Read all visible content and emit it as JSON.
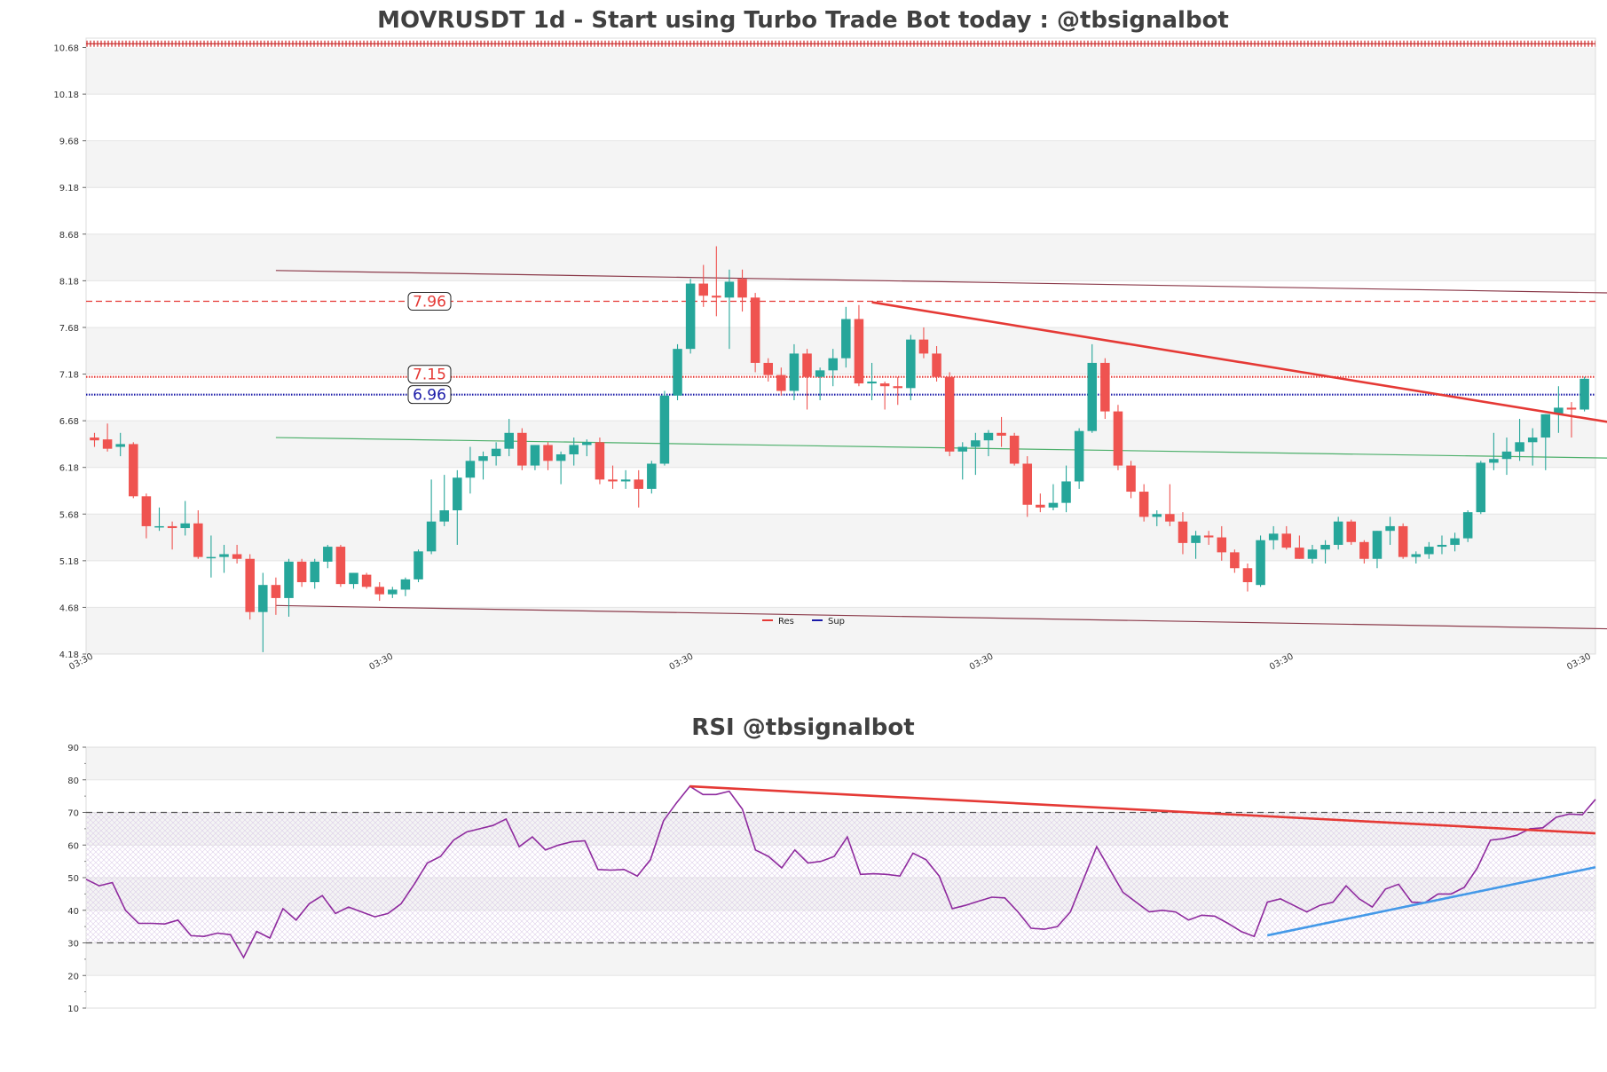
{
  "chart_data": [
    {
      "type": "candlestick",
      "title": "MOVRUSDT 1d - Start using Turbo Trade Bot today : @tbsignalbot",
      "ylim": [
        4.18,
        10.78
      ],
      "y_ticks": [
        "4.18",
        "4.68",
        "5.18",
        "5.68",
        "6.18",
        "6.68",
        "7.18",
        "7.68",
        "8.18",
        "8.68",
        "9.18",
        "9.68",
        "10.18",
        "10.68"
      ],
      "x_tick_labels": [
        "03:30",
        "03:30",
        "03:30",
        "03:30",
        "03:30",
        "03:30"
      ],
      "colors": {
        "up": "#26a69a",
        "down": "#ef5350",
        "resistance": "#e53935",
        "support": "#1a1aa8",
        "channel": "#8b3a4a",
        "mid_channel": "#4caf6a"
      },
      "levels": [
        {
          "label": "7.96",
          "value": 7.96,
          "kind": "resistance",
          "style": "dashed"
        },
        {
          "label": "7.15",
          "value": 7.15,
          "kind": "resistance",
          "style": "dotted"
        },
        {
          "label": "6.96",
          "value": 6.96,
          "kind": "support",
          "style": "dotted"
        }
      ],
      "top_marker_level": 10.72,
      "legend": [
        {
          "name": "Res",
          "color": "#e53935"
        },
        {
          "name": "Sup",
          "color": "#1a1aa8"
        }
      ],
      "channel_lines": [
        {
          "start_index": 14,
          "start": 8.29,
          "end_index": 117,
          "end": 8.05,
          "color": "#8b3a4a"
        },
        {
          "start_index": 14,
          "start": 6.5,
          "end_index": 117,
          "end": 6.28,
          "color": "#4caf6a"
        },
        {
          "start_index": 14,
          "start": 4.7,
          "end_index": 117,
          "end": 4.45,
          "color": "#8b3a4a"
        }
      ],
      "trendline": {
        "start_index": 60,
        "start": 7.95,
        "end_index": 118,
        "end": 6.64,
        "color": "#e53935"
      },
      "candles": [
        [
          6.5,
          6.55,
          6.4,
          6.47
        ],
        [
          6.48,
          6.65,
          6.35,
          6.38
        ],
        [
          6.4,
          6.55,
          6.3,
          6.43
        ],
        [
          6.43,
          6.45,
          5.85,
          5.87
        ],
        [
          5.87,
          5.9,
          5.42,
          5.55
        ],
        [
          5.55,
          5.75,
          5.5,
          5.55
        ],
        [
          5.55,
          5.6,
          5.3,
          5.53
        ],
        [
          5.53,
          5.82,
          5.45,
          5.58
        ],
        [
          5.58,
          5.72,
          5.2,
          5.22
        ],
        [
          5.22,
          5.45,
          5.0,
          5.22
        ],
        [
          5.22,
          5.35,
          5.05,
          5.25
        ],
        [
          5.25,
          5.35,
          5.15,
          5.2
        ],
        [
          5.2,
          5.25,
          4.55,
          4.63
        ],
        [
          4.63,
          5.05,
          4.2,
          4.92
        ],
        [
          4.92,
          5.0,
          4.6,
          4.78
        ],
        [
          4.78,
          5.2,
          4.58,
          5.17
        ],
        [
          5.17,
          5.2,
          4.9,
          4.95
        ],
        [
          4.95,
          5.2,
          4.88,
          5.17
        ],
        [
          5.17,
          5.35,
          5.1,
          5.33
        ],
        [
          5.33,
          5.35,
          4.9,
          4.93
        ],
        [
          4.93,
          5.05,
          4.88,
          5.05
        ],
        [
          5.03,
          5.05,
          4.88,
          4.9
        ],
        [
          4.9,
          4.95,
          4.75,
          4.82
        ],
        [
          4.82,
          4.9,
          4.78,
          4.87
        ],
        [
          4.87,
          5.0,
          4.8,
          4.98
        ],
        [
          4.98,
          5.3,
          4.95,
          5.28
        ],
        [
          5.28,
          6.05,
          5.25,
          5.6
        ],
        [
          5.6,
          6.1,
          5.55,
          5.72
        ],
        [
          5.72,
          6.15,
          5.35,
          6.07
        ],
        [
          6.07,
          6.4,
          5.9,
          6.25
        ],
        [
          6.25,
          6.35,
          6.05,
          6.3
        ],
        [
          6.3,
          6.45,
          6.2,
          6.38
        ],
        [
          6.38,
          6.7,
          6.3,
          6.55
        ],
        [
          6.55,
          6.6,
          6.15,
          6.2
        ],
        [
          6.2,
          6.42,
          6.15,
          6.42
        ],
        [
          6.42,
          6.45,
          6.15,
          6.25
        ],
        [
          6.25,
          6.35,
          6.0,
          6.32
        ],
        [
          6.32,
          6.5,
          6.2,
          6.42
        ],
        [
          6.42,
          6.48,
          6.3,
          6.45
        ],
        [
          6.45,
          6.5,
          6.0,
          6.05
        ],
        [
          6.05,
          6.2,
          5.95,
          6.03
        ],
        [
          6.03,
          6.15,
          5.95,
          6.05
        ],
        [
          6.05,
          6.15,
          5.75,
          5.95
        ],
        [
          5.95,
          6.25,
          5.9,
          6.22
        ],
        [
          6.22,
          7.0,
          6.2,
          6.95
        ],
        [
          6.95,
          7.5,
          6.9,
          7.45
        ],
        [
          7.45,
          8.2,
          7.4,
          8.15
        ],
        [
          8.15,
          8.35,
          7.9,
          8.02
        ],
        [
          8.02,
          8.55,
          7.8,
          8.0
        ],
        [
          8.0,
          8.3,
          7.45,
          8.17
        ],
        [
          8.2,
          8.3,
          7.85,
          8.0
        ],
        [
          8.0,
          8.05,
          7.2,
          7.3
        ],
        [
          7.3,
          7.35,
          7.1,
          7.17
        ],
        [
          7.17,
          7.25,
          6.95,
          7.0
        ],
        [
          7.0,
          7.5,
          6.9,
          7.4
        ],
        [
          7.4,
          7.45,
          6.8,
          7.15
        ],
        [
          7.15,
          7.25,
          6.9,
          7.22
        ],
        [
          7.22,
          7.45,
          7.05,
          7.35
        ],
        [
          7.35,
          7.9,
          7.25,
          7.77
        ],
        [
          7.77,
          7.92,
          7.05,
          7.08
        ],
        [
          7.08,
          7.3,
          6.9,
          7.1
        ],
        [
          7.08,
          7.1,
          6.8,
          7.05
        ],
        [
          7.05,
          7.15,
          6.85,
          7.03
        ],
        [
          7.03,
          7.6,
          6.9,
          7.55
        ],
        [
          7.55,
          7.68,
          7.35,
          7.4
        ],
        [
          7.4,
          7.48,
          7.1,
          7.15
        ],
        [
          7.15,
          7.2,
          6.3,
          6.35
        ],
        [
          6.35,
          6.45,
          6.05,
          6.4
        ],
        [
          6.4,
          6.55,
          6.1,
          6.47
        ],
        [
          6.47,
          6.58,
          6.3,
          6.55
        ],
        [
          6.55,
          6.72,
          6.4,
          6.52
        ],
        [
          6.52,
          6.55,
          6.2,
          6.22
        ],
        [
          6.22,
          6.3,
          5.65,
          5.78
        ],
        [
          5.78,
          5.9,
          5.7,
          5.75
        ],
        [
          5.75,
          6.0,
          5.72,
          5.8
        ],
        [
          5.8,
          6.2,
          5.7,
          6.03
        ],
        [
          6.03,
          6.6,
          5.95,
          6.57
        ],
        [
          6.57,
          7.5,
          6.55,
          7.3
        ],
        [
          7.3,
          7.35,
          6.7,
          6.78
        ],
        [
          6.78,
          6.85,
          6.15,
          6.2
        ],
        [
          6.2,
          6.25,
          5.85,
          5.92
        ],
        [
          5.92,
          6.0,
          5.6,
          5.65
        ],
        [
          5.65,
          5.72,
          5.55,
          5.68
        ],
        [
          5.68,
          6.0,
          5.55,
          5.6
        ],
        [
          5.6,
          5.7,
          5.25,
          5.37
        ],
        [
          5.37,
          5.5,
          5.2,
          5.45
        ],
        [
          5.45,
          5.5,
          5.35,
          5.43
        ],
        [
          5.43,
          5.55,
          5.18,
          5.27
        ],
        [
          5.27,
          5.3,
          5.05,
          5.1
        ],
        [
          5.1,
          5.15,
          4.85,
          4.95
        ],
        [
          4.92,
          5.45,
          4.9,
          5.4
        ],
        [
          5.4,
          5.55,
          5.3,
          5.47
        ],
        [
          5.47,
          5.55,
          5.3,
          5.32
        ],
        [
          5.32,
          5.45,
          5.2,
          5.2
        ],
        [
          5.2,
          5.35,
          5.15,
          5.3
        ],
        [
          5.3,
          5.4,
          5.15,
          5.35
        ],
        [
          5.35,
          5.65,
          5.3,
          5.6
        ],
        [
          5.6,
          5.62,
          5.35,
          5.38
        ],
        [
          5.38,
          5.4,
          5.15,
          5.2
        ],
        [
          5.2,
          5.5,
          5.1,
          5.5
        ],
        [
          5.5,
          5.65,
          5.35,
          5.55
        ],
        [
          5.55,
          5.58,
          5.2,
          5.22
        ],
        [
          5.22,
          5.28,
          5.15,
          5.25
        ],
        [
          5.25,
          5.38,
          5.2,
          5.33
        ],
        [
          5.33,
          5.45,
          5.25,
          5.35
        ],
        [
          5.35,
          5.48,
          5.28,
          5.42
        ],
        [
          5.42,
          5.72,
          5.38,
          5.7
        ],
        [
          5.7,
          6.25,
          5.68,
          6.23
        ],
        [
          6.23,
          6.55,
          6.15,
          6.27
        ],
        [
          6.27,
          6.5,
          6.1,
          6.35
        ],
        [
          6.35,
          6.7,
          6.25,
          6.45
        ],
        [
          6.45,
          6.6,
          6.2,
          6.5
        ],
        [
          6.5,
          6.75,
          6.15,
          6.75
        ],
        [
          6.75,
          7.05,
          6.55,
          6.82
        ],
        [
          6.82,
          6.88,
          6.5,
          6.8
        ],
        [
          6.8,
          7.15,
          6.78,
          7.13
        ]
      ]
    },
    {
      "type": "line",
      "title": "RSI @tbsignalbot",
      "ylim": [
        10,
        90
      ],
      "y_ticks": [
        "10",
        "20",
        "30",
        "40",
        "50",
        "60",
        "70",
        "80",
        "90"
      ],
      "bands": [
        30,
        70
      ],
      "colors": {
        "rsi": "#8e2a9e",
        "downtrend": "#e53935",
        "uptrend": "#4499e8"
      },
      "values": [
        49.5,
        47.5,
        48.5,
        40,
        36,
        36,
        35.8,
        37,
        32.2,
        32,
        33,
        32.5,
        25.5,
        33.5,
        31.5,
        40.5,
        37,
        42,
        44.5,
        39,
        41,
        39.5,
        38,
        39,
        42,
        48,
        54.5,
        56.5,
        61.5,
        64,
        65,
        66,
        68,
        59.5,
        62.5,
        58.5,
        60,
        61,
        61.3,
        52.5,
        52.3,
        52.5,
        50.5,
        55.5,
        67.5,
        73,
        78,
        75.5,
        75.5,
        76.5,
        71,
        58.5,
        56.5,
        53,
        58.5,
        54.5,
        55,
        56.5,
        62.5,
        51,
        51.2,
        51,
        50.5,
        57.5,
        55.5,
        50.5,
        40.5,
        41.5,
        42.8,
        44,
        43.8,
        39.5,
        34.5,
        34.2,
        35,
        39.5,
        49.5,
        59.5,
        52.5,
        45.5,
        42.5,
        39.5,
        40,
        39.5,
        37,
        38.5,
        38.2,
        36,
        33.5,
        32,
        42.5,
        43.5,
        41.5,
        39.5,
        41.5,
        42.5,
        47.5,
        43.5,
        41,
        46.5,
        48,
        42.5,
        42.3,
        45,
        45,
        47,
        53,
        61.5,
        62,
        63,
        65,
        65.3,
        68.5,
        69.5,
        69.3,
        74
      ],
      "downtrend": {
        "start_index": 46,
        "start": 78,
        "end_index": 117,
        "end": 63.6
      },
      "uptrend": {
        "start_index": 90,
        "start": 32.3,
        "end_index": 117,
        "end": 53.2
      }
    }
  ]
}
